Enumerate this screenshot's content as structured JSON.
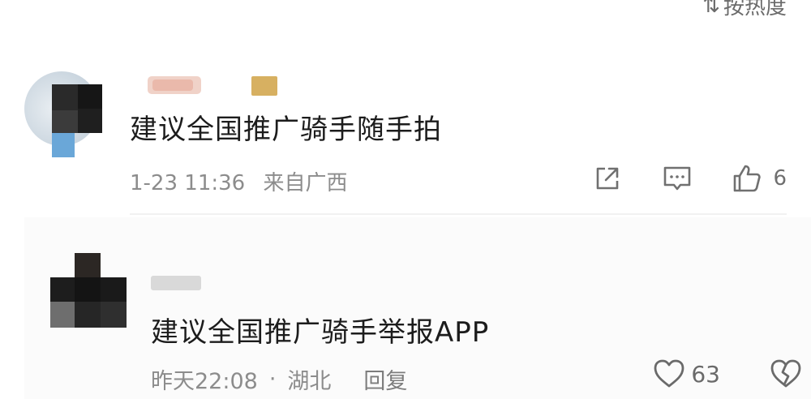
{
  "sort": {
    "label": "按热度",
    "icon": "sort-icon"
  },
  "comments": [
    {
      "text": "建议全国推广骑手随手拍",
      "time": "1-23 11:36",
      "location": "来自广西",
      "actions": {
        "share_icon": "share-icon",
        "comment_icon": "comment-icon",
        "like_icon": "thumbs-up-icon",
        "likes": "6"
      }
    },
    {
      "text": "建议全国推广骑手举报APP",
      "time": "昨天22:08",
      "separator": "·",
      "location": "湖北",
      "reply_label": "回复",
      "actions": {
        "like_icon": "heart-icon",
        "likes": "63",
        "dislike_icon": "broken-heart-icon"
      }
    }
  ]
}
